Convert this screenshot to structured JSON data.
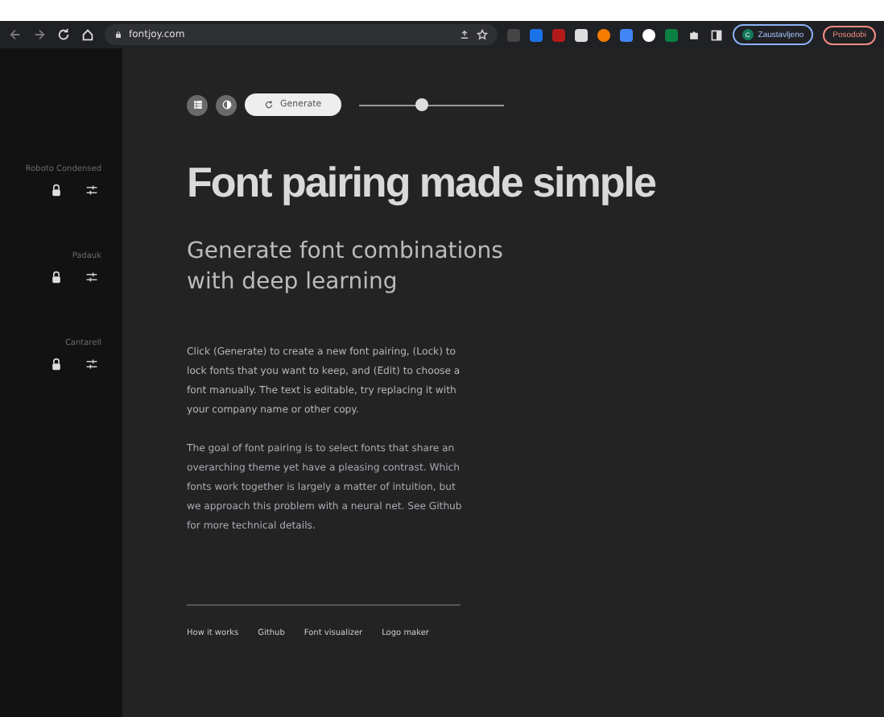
{
  "browser": {
    "url": "fontjoy.com",
    "profile": "Zaustavljeno",
    "update": "Posodobi",
    "profile_initial": "C"
  },
  "sidebar": {
    "fonts": [
      {
        "name": "Roboto Condensed"
      },
      {
        "name": "Padauk"
      },
      {
        "name": "Cantarell"
      }
    ]
  },
  "toolbar": {
    "generate": "Generate",
    "slider": {
      "level": 0.44
    }
  },
  "heading": "Font pairing made simple",
  "subheading": "Generate font combinations with deep learning",
  "paragraphs": [
    "Click (Generate) to create a new font pairing, (Lock) to lock fonts that you want to keep, and (Edit) to choose a font manually. The text is editable, try replacing it with your company name or other copy.",
    "The goal of font pairing is to select fonts that share an overarching theme yet have a pleasing contrast. Which fonts work together is largely a matter of intuition, but we approach this problem with a neural net. See Github for more technical details."
  ],
  "footer_links": [
    "How it works",
    "Github",
    "Font visualizer",
    "Logo maker"
  ]
}
